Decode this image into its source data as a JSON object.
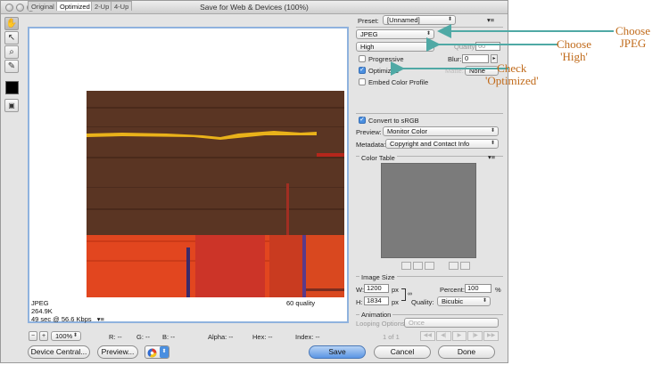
{
  "window": {
    "title": "Save for Web & Devices (100%)"
  },
  "tabs": [
    "Original",
    "Optimized",
    "2-Up",
    "4-Up"
  ],
  "image_info": {
    "format": "JPEG",
    "size": "264.9K",
    "time": "49 sec @ 56.6 Kbps",
    "menu_glyph": "▾≡",
    "quality": "60 quality"
  },
  "statusbar": {
    "zoom": "100%",
    "r": "R: --",
    "g": "G: --",
    "b": "B: --",
    "alpha": "Alpha: --",
    "hex": "Hex: --",
    "index": "Index: --"
  },
  "buttons": {
    "device_central": "Device Central...",
    "preview": "Preview...",
    "save": "Save",
    "cancel": "Cancel",
    "done": "Done"
  },
  "settings": {
    "preset_label": "Preset:",
    "preset_value": "[Unnamed]",
    "format_value": "JPEG",
    "quality_preset": "High",
    "quality_label": "Quality:",
    "quality_value": "60",
    "progressive_label": "Progressive",
    "blur_label": "Blur:",
    "blur_value": "0",
    "optimized_label": "Optimized",
    "matte_label": "Matte:",
    "matte_value": "None",
    "embed_label": "Embed Color Profile",
    "srgb_label": "Convert to sRGB",
    "preview_label": "Preview:",
    "preview_value": "Monitor Color",
    "metadata_label": "Metadata:",
    "metadata_value": "Copyright and Contact Info"
  },
  "color_table": {
    "label": "Color Table"
  },
  "image_size": {
    "label": "Image Size",
    "w_label": "W:",
    "w_value": "1200",
    "h_label": "H:",
    "h_value": "1834",
    "unit": "px",
    "percent_label": "Percent:",
    "percent_value": "100",
    "percent_unit": "%",
    "quality_label": "Quality:",
    "quality_value": "Bicubic"
  },
  "animation": {
    "label": "Animation",
    "looping_label": "Looping Options:",
    "looping_value": "Once",
    "frame": "1 of 1"
  },
  "annotations": {
    "jpeg": "Choose\nJPEG",
    "high": "Choose\n'High'",
    "optimized": "Check\n'Optimized'"
  },
  "colors": {
    "accent": "#5a95e4",
    "annotation": "#c06a1a",
    "arrow": "#4fa9a5"
  }
}
